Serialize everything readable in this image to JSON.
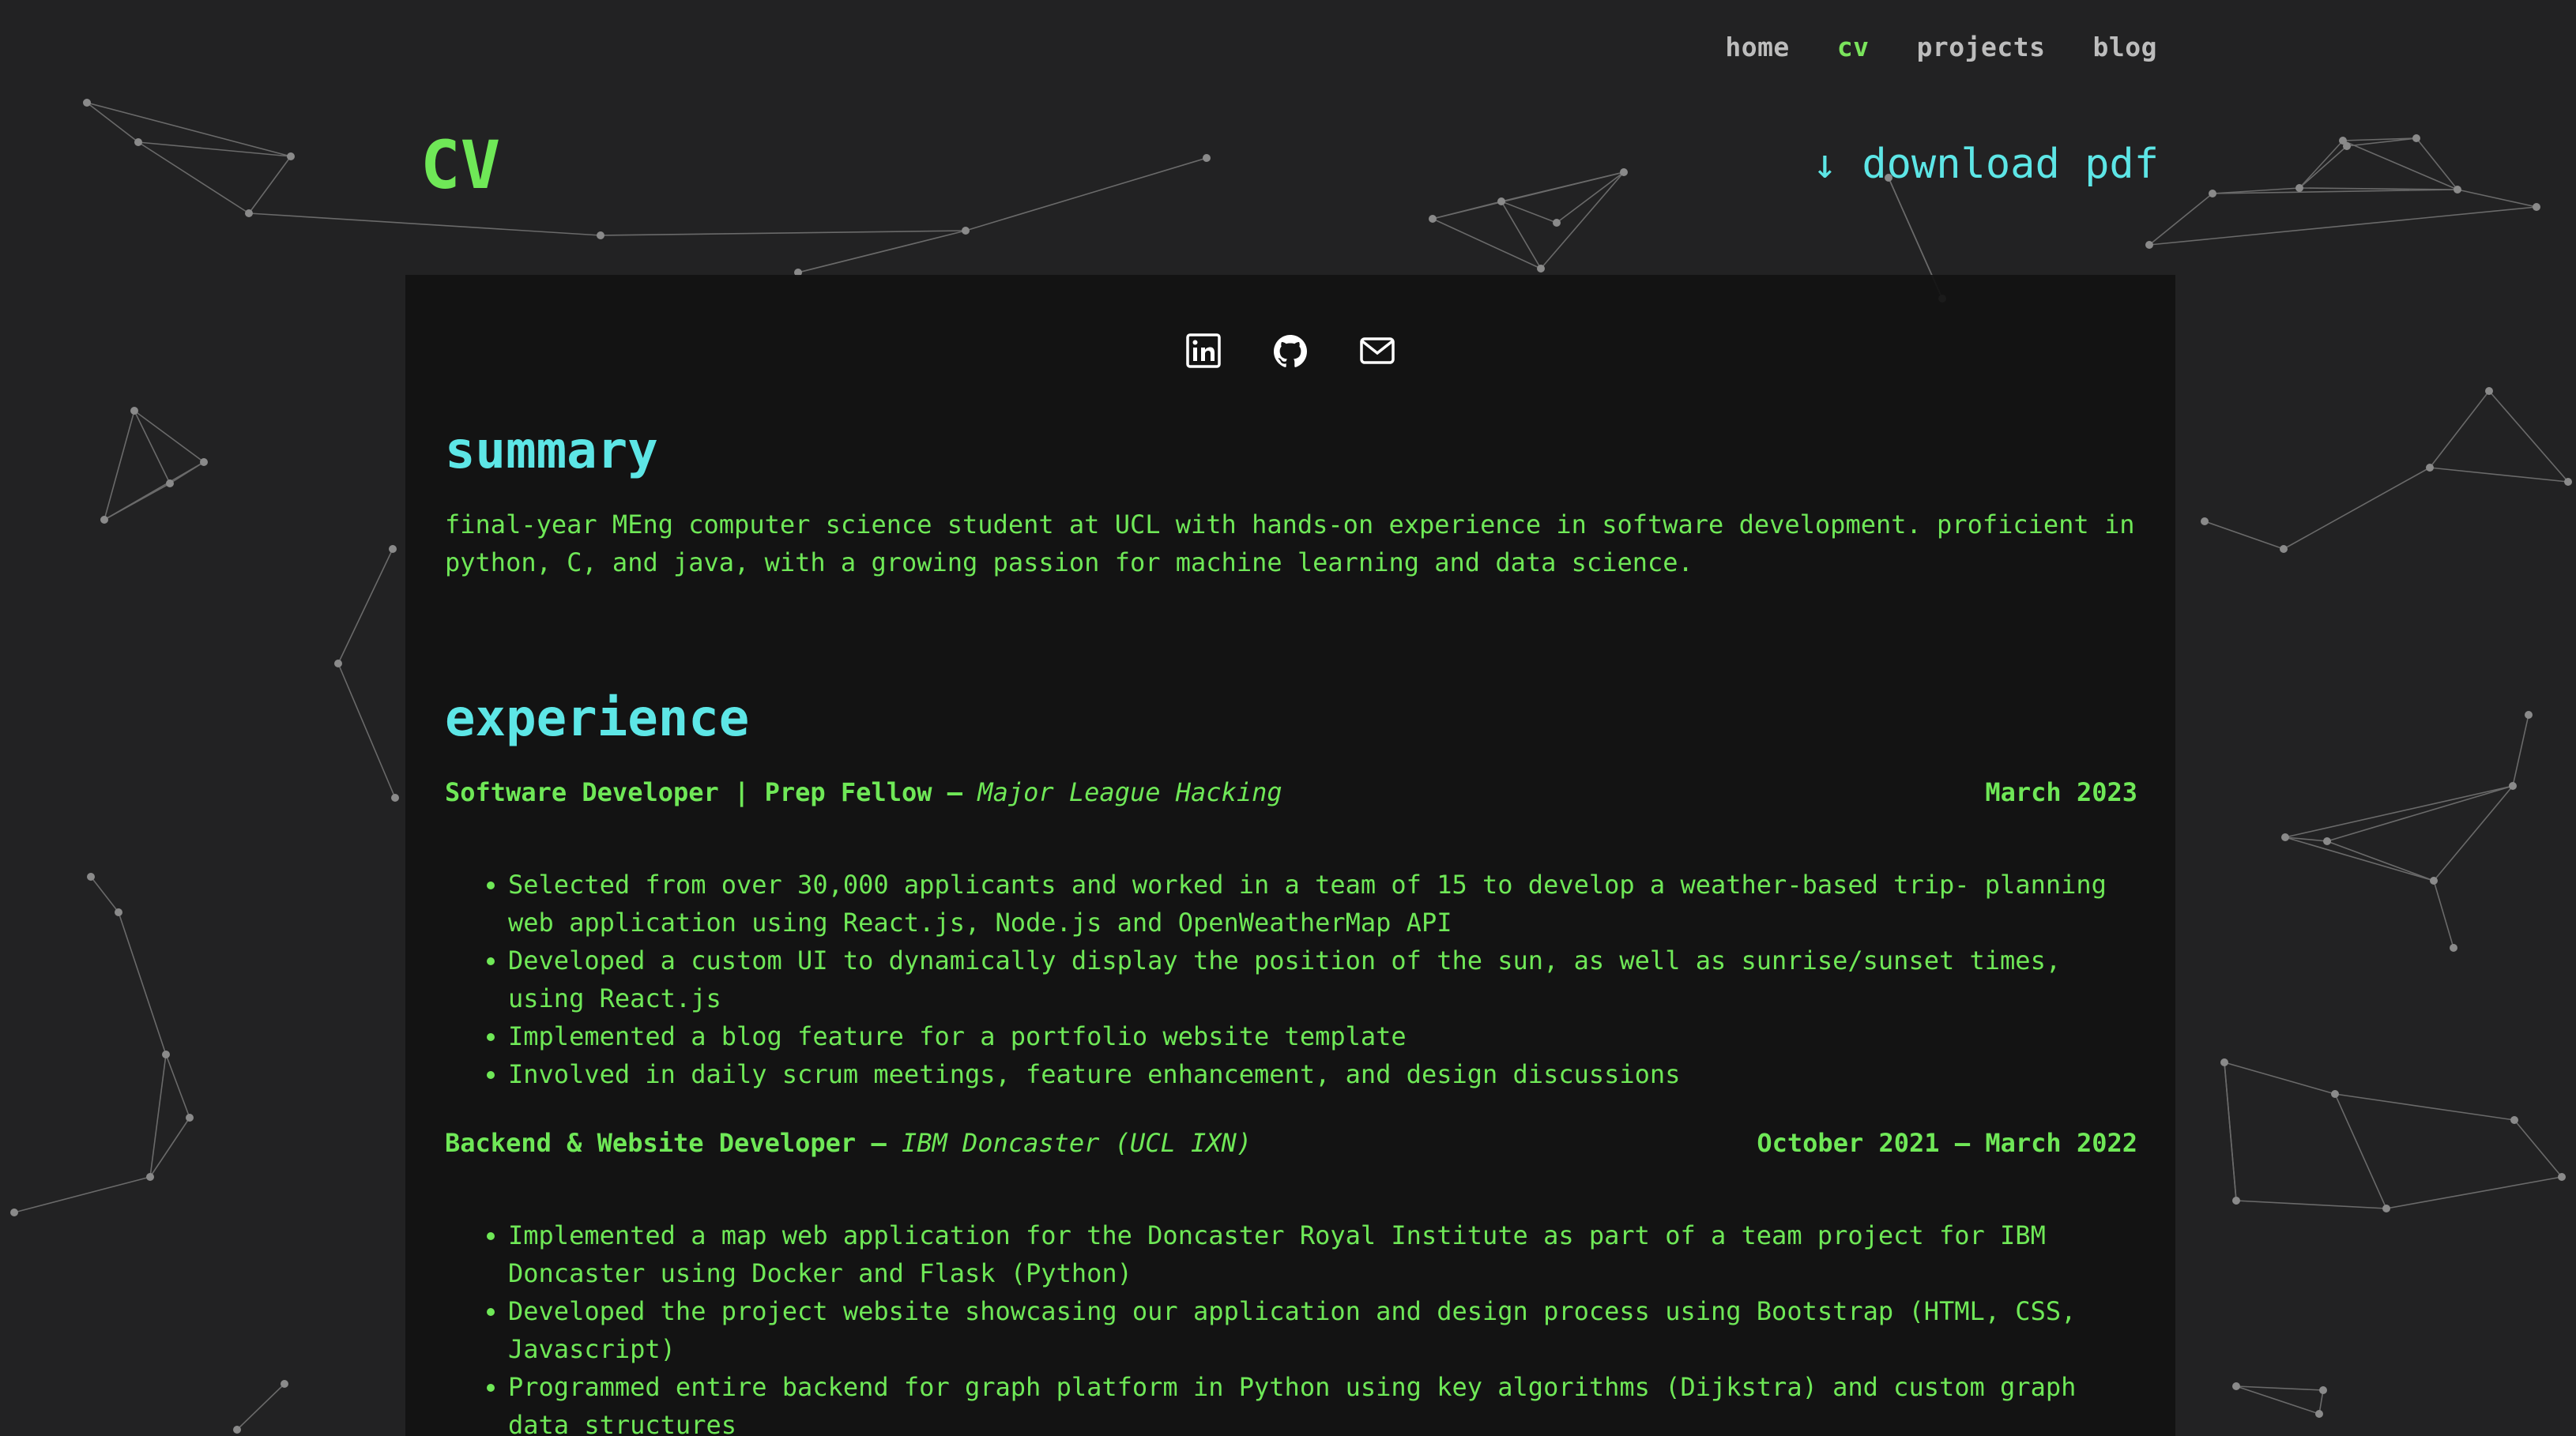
{
  "nav": {
    "items": [
      {
        "label": "home",
        "active": false
      },
      {
        "label": "cv",
        "active": true
      },
      {
        "label": "projects",
        "active": false
      },
      {
        "label": "blog",
        "active": false
      }
    ]
  },
  "header": {
    "title": "CV",
    "download_label": "↓ download pdf"
  },
  "socials": [
    {
      "icon": "linkedin-icon"
    },
    {
      "icon": "github-icon"
    },
    {
      "icon": "email-icon"
    }
  ],
  "summary": {
    "heading": "summary",
    "text": "final-year MEng computer science student at UCL with hands-on experience in software development. proficient in python, C, and java, with a growing passion for machine learning and data science."
  },
  "experience": {
    "heading": "experience",
    "jobs": [
      {
        "role": "Software Developer | Prep Fellow",
        "org": "Major League Hacking",
        "date": "March 2023",
        "bullets": [
          "Selected from over 30,000 applicants and worked in a team of 15 to develop a weather-based trip- planning web application using React.js, Node.js and OpenWeatherMap API",
          "Developed a custom UI to dynamically display the position of the sun, as well as sunrise/sunset times, using React.js",
          "Implemented a blog feature for a portfolio website template",
          "Involved in daily scrum meetings, feature enhancement, and design discussions"
        ]
      },
      {
        "role": "Backend & Website Developer",
        "org": "IBM Doncaster (UCL IXN)",
        "date": "October 2021 – March 2022",
        "bullets": [
          "Implemented a map web application for the Doncaster Royal Institute as part of a team project for IBM Doncaster using Docker and Flask (Python)",
          "Developed the project website showcasing our application and design process using Bootstrap (HTML, CSS, Javascript)",
          "Programmed entire backend for graph platform in Python using key algorithms (Dijkstra) and custom graph data structures"
        ]
      }
    ]
  },
  "colors": {
    "background": "#222223",
    "panel": "#121212",
    "accent_green": "#6fe857",
    "accent_cyan": "#5de6e6",
    "nav_text": "#bdbdbd"
  }
}
